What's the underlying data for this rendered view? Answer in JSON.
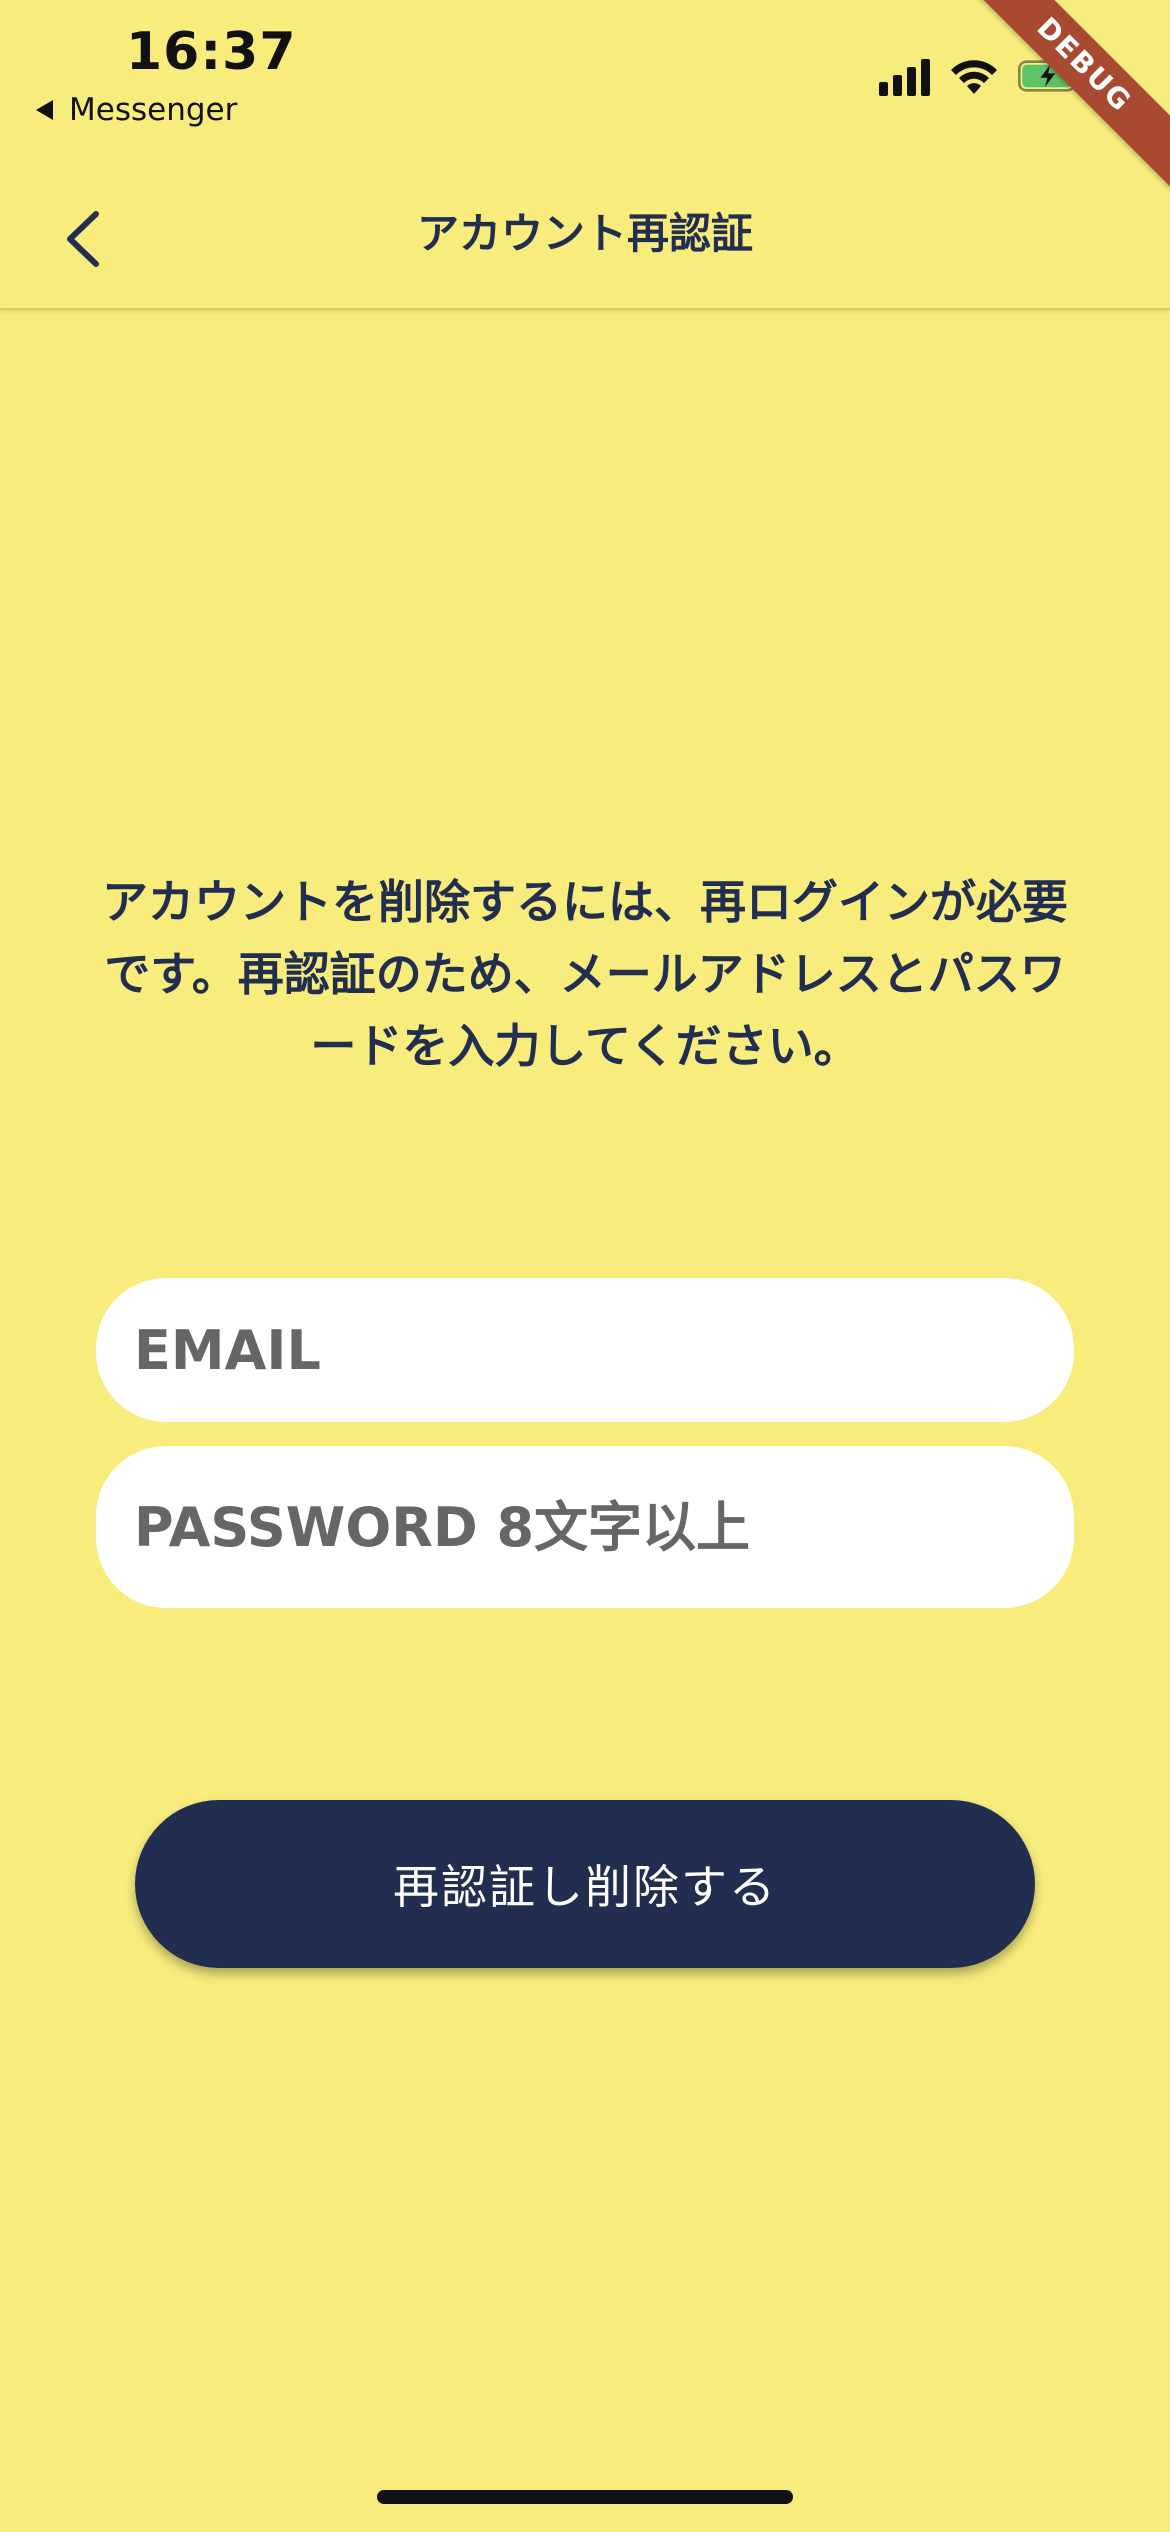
{
  "status_bar": {
    "time": "16:37",
    "back_app_label": "Messenger"
  },
  "debug_banner": "DEBUG",
  "nav": {
    "title": "アカウント再認証"
  },
  "instructions": "アカウントを削除するには、再ログインが必要です。再認証のため、メールアドレスとパスワードを入力してください。",
  "form": {
    "email_placeholder": "EMAIL",
    "password_placeholder": "PASSWORD 8文字以上"
  },
  "submit_label": "再認証し削除する",
  "colors": {
    "background": "#f7ec7c",
    "primary": "#222e4f",
    "input_bg": "#ffffff",
    "debug_ribbon": "#a84a32",
    "battery_fill": "#5cc466"
  },
  "icons": [
    "back-chevron-icon",
    "signal-icon",
    "wifi-icon",
    "battery-charging-icon"
  ]
}
